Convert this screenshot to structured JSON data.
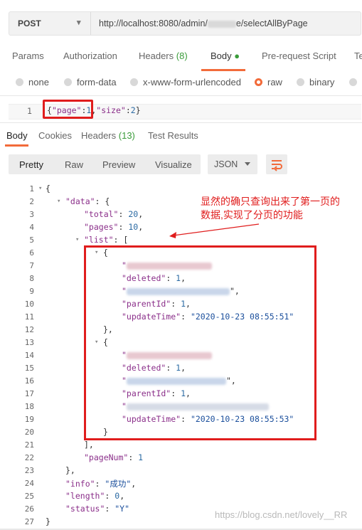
{
  "request": {
    "method": "POST",
    "url_prefix": "http://localhost:8080/admin/",
    "url_suffix": "e/selectAllByPage",
    "tabs": [
      {
        "label": "Params"
      },
      {
        "label": "Authorization"
      },
      {
        "label": "Headers",
        "count": "(8)"
      },
      {
        "label": "Body",
        "active": true
      },
      {
        "label": "Pre-request Script"
      },
      {
        "label": "Te"
      }
    ],
    "body_types": [
      "none",
      "form-data",
      "x-www-form-urlencoded",
      "raw",
      "binary"
    ],
    "selected_body_type": "raw",
    "body_line_no": "1",
    "body_code": {
      "open": "{",
      "k1": "\"page\"",
      "v1": "1",
      "k2": "\"size\"",
      "v2": "2",
      "close": "}"
    }
  },
  "response": {
    "tabs": [
      "Body",
      "Cookies",
      "Headers",
      "(13)",
      "Test Results"
    ],
    "view_modes": [
      "Pretty",
      "Raw",
      "Preview",
      "Visualize"
    ],
    "format": "JSON"
  },
  "json": {
    "data_key": "\"data\"",
    "total_key": "\"total\"",
    "total": "20",
    "pages_key": "\"pages\"",
    "pages": "10",
    "list_key": "\"list\"",
    "deleted_key": "\"deleted\"",
    "deleted": "1",
    "parentId_key": "\"parentId\"",
    "parentId": "1",
    "updateTime_key": "\"updateTime\"",
    "updateTime_1": "\"2020-10-23 08:55:51\"",
    "updateTime_2": "\"2020-10-23 08:55:53\"",
    "pageNum_key": "\"pageNum\"",
    "pageNum": "1",
    "info_key": "\"info\"",
    "info": "\"成功\"",
    "length_key": "\"length\"",
    "length": "0",
    "status_key": "\"status\"",
    "status": "\"Y\""
  },
  "line_numbers": [
    "1",
    "2",
    "3",
    "4",
    "5",
    "6",
    "7",
    "8",
    "9",
    "10",
    "11",
    "12",
    "13",
    "14",
    "15",
    "16",
    "17",
    "18",
    "19",
    "20",
    "21",
    "22",
    "23",
    "24",
    "25",
    "26",
    "27"
  ],
  "annotation": {
    "line1": "显然的确只查询出来了第一页的",
    "line2": "数据,实现了分页的功能"
  },
  "watermark": "https://blog.csdn.net/lovely__RR",
  "colors": {
    "accent": "#f26b3a",
    "highlight": "#e01d1d"
  }
}
